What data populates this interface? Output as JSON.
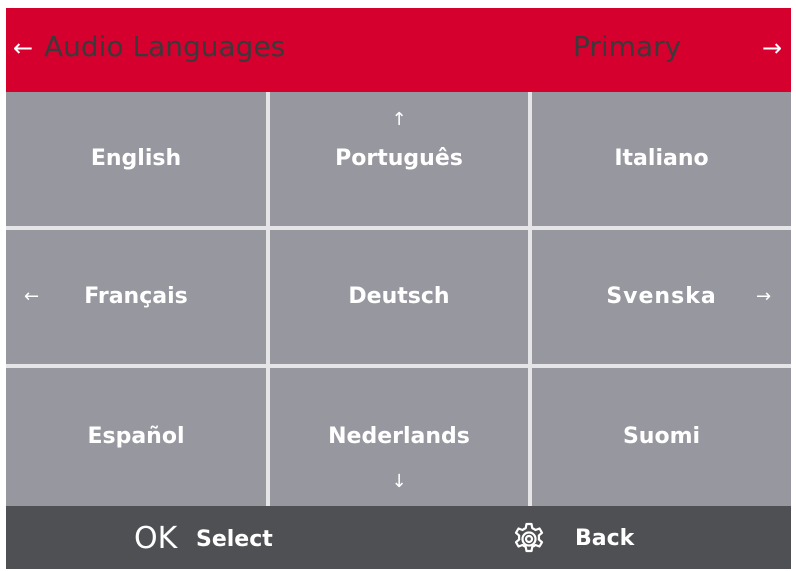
{
  "header": {
    "title": "Audio Languages",
    "mode": "Primary",
    "left_arrow": "←",
    "right_arrow": "→"
  },
  "grid": {
    "cells": [
      {
        "label": "English"
      },
      {
        "label": "Português"
      },
      {
        "label": "Italiano"
      },
      {
        "label": "Français"
      },
      {
        "label": "Deutsch"
      },
      {
        "label": "Svenska"
      },
      {
        "label": "Español"
      },
      {
        "label": "Nederlands"
      },
      {
        "label": "Suomi"
      }
    ],
    "arrows": {
      "up": "↑",
      "down": "↓",
      "left": "←",
      "right": "→"
    }
  },
  "footer": {
    "ok_glyph": "OK",
    "ok_label": "Select",
    "back_label": "Back",
    "back_icon": "gear-icon"
  },
  "colors": {
    "header_bg": "#d6002f",
    "cell_bg": "#97989f",
    "footer_bg": "#4f5054",
    "divider": "#e5e5e8"
  }
}
